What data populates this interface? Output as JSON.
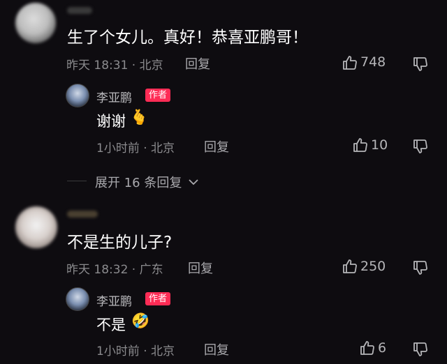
{
  "comments": [
    {
      "text": "生了个女儿。真好！恭喜亚鹏哥！",
      "meta": "昨天 18:31 · 北京",
      "reply_label": "回复",
      "likes": "748",
      "replies": [
        {
          "author": "李亚鹏",
          "badge": "作者",
          "text": "谢谢",
          "emoji": "🫰",
          "meta": "1小时前 · 北京",
          "reply_label": "回复",
          "likes": "10"
        }
      ],
      "expand_label": "展开 16 条回复"
    },
    {
      "text": "不是生的儿子?",
      "meta": "昨天 18:32 · 广东",
      "reply_label": "回复",
      "likes": "250",
      "replies": [
        {
          "author": "李亚鹏",
          "badge": "作者",
          "text": "不是",
          "emoji": "🤣",
          "meta": "1小时前 · 北京",
          "reply_label": "回复",
          "likes": "6"
        }
      ]
    }
  ],
  "icons": {
    "like": "thumbs-up-icon",
    "dislike": "thumbs-down-icon",
    "expand": "chevron-down-icon"
  },
  "colors": {
    "background": "#0e0c10",
    "author_badge": "#fe2c55",
    "meta_text": "#8b8b8e"
  }
}
